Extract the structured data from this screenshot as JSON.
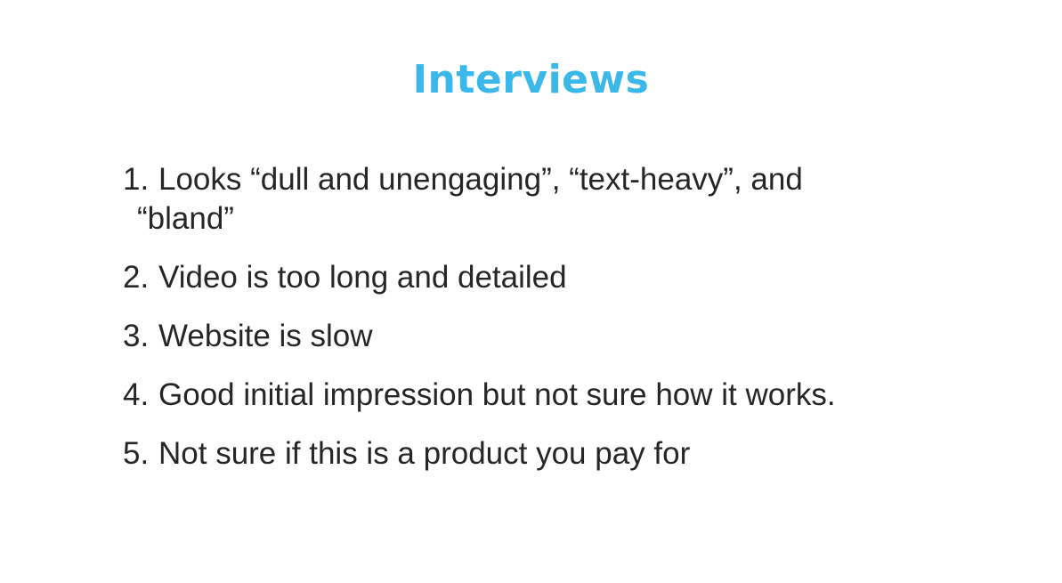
{
  "slide": {
    "title": "Interviews",
    "items": [
      {
        "number": "1.",
        "text_line1": "Looks “dull and unengaging”, “text-heavy”, and",
        "text_line2": "“bland”"
      },
      {
        "number": "2.",
        "text": "Video is too long and detailed"
      },
      {
        "number": "3.",
        "text": "Website is slow"
      },
      {
        "number": "4.",
        "text": "Good initial impression but not sure how it works."
      },
      {
        "number": "5.",
        "text": "Not sure if this is a product you pay for"
      }
    ],
    "colors": {
      "title": "#3bb8ea",
      "body_text": "#262626",
      "background": "#ffffff"
    }
  }
}
